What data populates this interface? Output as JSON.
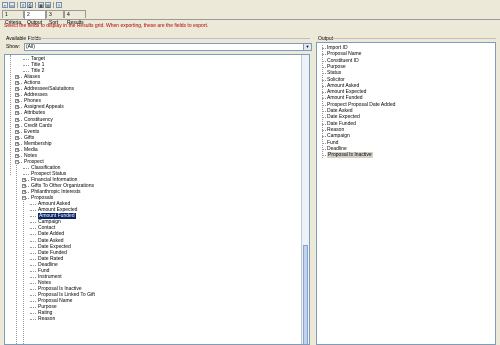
{
  "toolbar": {
    "buttons": [
      "save-icon",
      "folder-icon",
      "export-icon",
      "print-icon",
      "chart-icon",
      "table-icon",
      "help-icon"
    ]
  },
  "tabs": [
    {
      "label": "1 Criteria",
      "active": false
    },
    {
      "label": "2 Output",
      "active": true
    },
    {
      "label": "3 Sort",
      "active": false
    },
    {
      "label": "4 Results",
      "active": false
    }
  ],
  "instruction": "Select the fields to display in the Results grid. When exporting, these are the fields to export.",
  "available": {
    "title": "Available Fields",
    "show_label": "Show:",
    "show_value": "(All)"
  },
  "tree_items": [
    {
      "label": "Target",
      "level": 2,
      "exp": ""
    },
    {
      "label": "Title 1",
      "level": 2,
      "exp": ""
    },
    {
      "label": "Title 2",
      "level": 2,
      "exp": ""
    },
    {
      "label": "Aliases",
      "level": 1,
      "exp": "+"
    },
    {
      "label": "Actions",
      "level": 1,
      "exp": "+"
    },
    {
      "label": "Addressee/Salutations",
      "level": 1,
      "exp": "+"
    },
    {
      "label": "Addresses",
      "level": 1,
      "exp": "+"
    },
    {
      "label": "Phones",
      "level": 1,
      "exp": "+"
    },
    {
      "label": "Assigned Appeals",
      "level": 1,
      "exp": "+"
    },
    {
      "label": "Attributes",
      "level": 1,
      "exp": "+"
    },
    {
      "label": "Constituency",
      "level": 1,
      "exp": "+"
    },
    {
      "label": "Credit Cards",
      "level": 1,
      "exp": "+"
    },
    {
      "label": "Events",
      "level": 1,
      "exp": "+"
    },
    {
      "label": "Gifts",
      "level": 1,
      "exp": "+"
    },
    {
      "label": "Membership",
      "level": 1,
      "exp": "+"
    },
    {
      "label": "Media",
      "level": 1,
      "exp": "+"
    },
    {
      "label": "Notes",
      "level": 1,
      "exp": "+"
    },
    {
      "label": "Prospect",
      "level": 1,
      "exp": "-"
    },
    {
      "label": "Classification",
      "level": 2,
      "exp": ""
    },
    {
      "label": "Prospect Status",
      "level": 2,
      "exp": ""
    },
    {
      "label": "Financial Information",
      "level": 2,
      "exp": "+"
    },
    {
      "label": "Gifts To Other Organizations",
      "level": 2,
      "exp": "+"
    },
    {
      "label": "Philanthropic Interests",
      "level": 2,
      "exp": "+"
    },
    {
      "label": "Proposals",
      "level": 2,
      "exp": "-"
    },
    {
      "label": "Amount Asked",
      "level": 3,
      "exp": ""
    },
    {
      "label": "Amount Expected",
      "level": 3,
      "exp": ""
    },
    {
      "label": "Amount Funded",
      "level": 3,
      "exp": "",
      "selected": true
    },
    {
      "label": "Campaign",
      "level": 3,
      "exp": ""
    },
    {
      "label": "Contact",
      "level": 3,
      "exp": ""
    },
    {
      "label": "Date Added",
      "level": 3,
      "exp": ""
    },
    {
      "label": "Date Asked",
      "level": 3,
      "exp": ""
    },
    {
      "label": "Date Expected",
      "level": 3,
      "exp": ""
    },
    {
      "label": "Date Funded",
      "level": 3,
      "exp": ""
    },
    {
      "label": "Date Rated",
      "level": 3,
      "exp": ""
    },
    {
      "label": "Deadline",
      "level": 3,
      "exp": ""
    },
    {
      "label": "Fund",
      "level": 3,
      "exp": ""
    },
    {
      "label": "Instrument",
      "level": 3,
      "exp": ""
    },
    {
      "label": "Notes",
      "level": 3,
      "exp": ""
    },
    {
      "label": "Proposal Is Inactive",
      "level": 3,
      "exp": ""
    },
    {
      "label": "Proposal Is Linked To Gift",
      "level": 3,
      "exp": ""
    },
    {
      "label": "Proposal Name",
      "level": 3,
      "exp": ""
    },
    {
      "label": "Purpose",
      "level": 3,
      "exp": ""
    },
    {
      "label": "Rating",
      "level": 3,
      "exp": ""
    },
    {
      "label": "Reason",
      "level": 3,
      "exp": ""
    }
  ],
  "output": {
    "title": "Output",
    "items": [
      {
        "label": "Import ID"
      },
      {
        "label": "Proposal Name"
      },
      {
        "label": "Constituent ID"
      },
      {
        "label": "Purpose"
      },
      {
        "label": "Status"
      },
      {
        "label": "Solicitor"
      },
      {
        "label": "Amount Asked"
      },
      {
        "label": "Amount Expected"
      },
      {
        "label": "Amount Funded"
      },
      {
        "label": "Prospect Proposal Date Added"
      },
      {
        "label": "Date Asked"
      },
      {
        "label": "Date Expected"
      },
      {
        "label": "Date Funded"
      },
      {
        "label": "Reason"
      },
      {
        "label": "Campaign"
      },
      {
        "label": "Fund"
      },
      {
        "label": "Deadline"
      },
      {
        "label": "Proposal Is Inactive",
        "highlight": true
      }
    ]
  }
}
